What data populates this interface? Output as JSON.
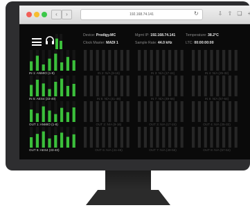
{
  "browser": {
    "url": "192.168.74.141",
    "back_icon": "chevron-left-icon",
    "forward_icon": "chevron-right-icon",
    "reload_icon": "reload-icon"
  },
  "header": {
    "device_label": "Device:",
    "device_value": "Prodigy.MC",
    "clock_label": "Clock Master:",
    "clock_value": "MADI 1",
    "mgmt_label": "Mgmt IP:",
    "mgmt_value": "192.168.74.141",
    "sample_label": "Sample Rate:",
    "sample_value": "44.0 kHz",
    "temp_label": "Temperature:",
    "temp_value": "38.2°C",
    "ltc_label": "LTC:",
    "ltc_value": "00:00:00:00"
  },
  "rows": [
    {
      "cells": [
        {
          "label": "IN 1: ANMIO (1-8)",
          "active": true,
          "levels": [
            0.45,
            0.72,
            0.3,
            0.58,
            0.82,
            0.4,
            0.66,
            0.5
          ]
        },
        {
          "label": "IN 2: N/A (9-16)",
          "active": false
        },
        {
          "label": "IN 3: N/A (17-24)",
          "active": false
        },
        {
          "label": "IN 4: N/A (25-32)",
          "active": false
        }
      ]
    },
    {
      "cells": [
        {
          "label": "IN 5: AES4 (33-40)",
          "active": true,
          "levels": [
            0.55,
            0.8,
            0.62,
            0.35,
            0.7,
            0.85,
            0.5,
            0.6
          ]
        },
        {
          "label": "IN 6: N/A (41-48)",
          "active": false
        },
        {
          "label": "IN 7: N/A (49-56)",
          "active": false
        },
        {
          "label": "IN 8: N/A (57-64)",
          "active": false
        }
      ]
    },
    {
      "cells": [
        {
          "label": "OUT 1: ANMIO (1-8)",
          "active": true,
          "levels": [
            0.6,
            0.42,
            0.75,
            0.55,
            0.38,
            0.68,
            0.47,
            0.7
          ]
        },
        {
          "label": "OUT 2: N/A (9-16)",
          "active": false
        },
        {
          "label": "OUT 3: N/A (17-24)",
          "active": false
        },
        {
          "label": "OUT 4: N/A (25-32)",
          "active": false
        }
      ]
    },
    {
      "cells": [
        {
          "label": "OUT 5: AES4 (33-40)",
          "active": true,
          "levels": [
            0.5,
            0.66,
            0.78,
            0.44,
            0.6,
            0.72,
            0.52,
            0.64
          ]
        },
        {
          "label": "OUT 6: N/A (41-48)",
          "active": false
        },
        {
          "label": "OUT 7: N/A (49-56)",
          "active": false
        },
        {
          "label": "OUT 8: N/A (57-64)",
          "active": false
        }
      ]
    }
  ],
  "headphone_levels": [
    0.7,
    0.55
  ],
  "colors": {
    "meter_green": "#3bbf3b",
    "meter_track": "#151515",
    "meter_dim": "#262626"
  }
}
